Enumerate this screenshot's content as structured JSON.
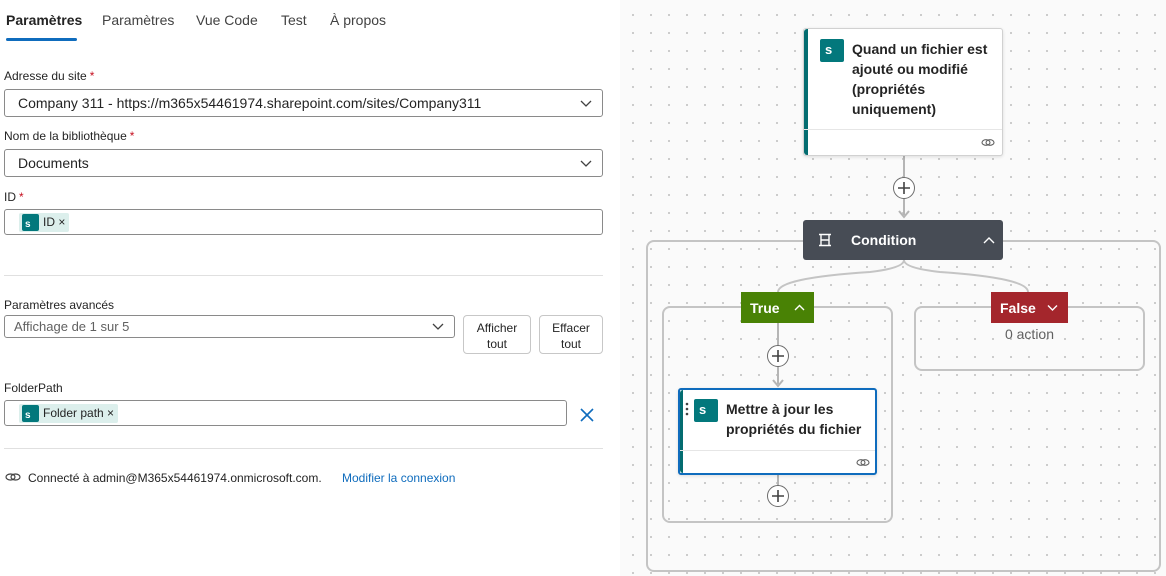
{
  "tabs": [
    "Paramètres",
    "Paramètres",
    "Vue Code",
    "Test",
    "À propos"
  ],
  "fields": {
    "site_label": "Adresse du site",
    "site_value": "Company 311 - https://m365x54461974.sharepoint.com/sites/Company311",
    "library_label": "Nom de la bibliothèque",
    "library_value": "Documents",
    "id_label": "ID",
    "id_token": "ID",
    "required_mark": "*",
    "token_remove": "×"
  },
  "advanced": {
    "label": "Paramètres avancés",
    "select_value": "Affichage de 1 sur 5",
    "show_all_line1": "Afficher",
    "show_all_line2": "tout",
    "clear_all_line1": "Effacer",
    "clear_all_line2": "tout"
  },
  "folder": {
    "label": "FolderPath",
    "token": "Folder path"
  },
  "connection": {
    "text": "Connecté à admin@M365x54461974.onmicrosoft.com.",
    "link": "Modifier la connexion"
  },
  "flow": {
    "trigger_line1": "Quand un fichier est",
    "trigger_line2": "ajouté ou modifié",
    "trigger_line3": "(propriétés",
    "trigger_line4": "uniquement)",
    "condition": "Condition",
    "true_label": "True",
    "false_label": "False",
    "false_empty": "0 action",
    "action_line1": "Mettre à jour les",
    "action_line2": "propriétés du fichier"
  },
  "colors": {
    "accent": "#0f6cbd",
    "sharepoint": "#036c70",
    "condition_header": "#474c55",
    "true_branch": "#498205",
    "false_branch": "#a4262c"
  },
  "icons": [
    "sharepoint-icon",
    "chevron-down-icon",
    "chevron-up-icon",
    "close-icon",
    "link-icon",
    "plus-icon",
    "condition-icon",
    "drag-handle-icon"
  ]
}
